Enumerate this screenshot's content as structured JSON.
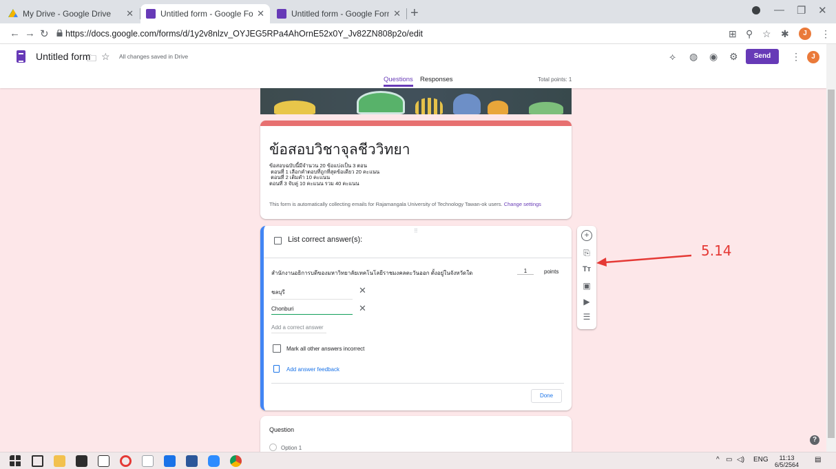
{
  "browser": {
    "tabs": [
      {
        "title": "My Drive - Google Drive",
        "favicon": "drive-icon"
      },
      {
        "title": "Untitled form - Google Forms",
        "favicon": "forms-icon"
      },
      {
        "title": "Untitled form - Google Forms",
        "favicon": "forms-icon"
      }
    ],
    "url": "https://docs.google.com/forms/d/1y2v8nlzv_OYJEG5RPa4AhOrnE52x0Y_Jv82ZN808p2o/edit",
    "profile_initial": "J"
  },
  "forms_header": {
    "title": "Untitled form",
    "saved_status": "All changes saved in Drive",
    "send_label": "Send",
    "tab_questions": "Questions",
    "tab_responses": "Responses",
    "total_points": "Total points: 1",
    "profile_initial": "J"
  },
  "title_card": {
    "title": "ข้อสอบวิชาจุลชีววิทยา",
    "description": "ข้อสอบฉบับนี้มีจำนวน 20 ข้อแบ่งเป็น 3 ตอน\n ตอนที่ 1 เลือกคำตอบที่ถูกที่สุดข้อเดียว 20 คะแนน\n ตอนที่ 2 เติมคำ 10 คะแนน\nตอนที่ 3 จับคู่ 10 คะแนน รวม 40 คะแนน",
    "notice": "This form is automatically collecting emails for Rajamangala University of Technology Tawan-ok users.",
    "notice_link": "Change settings"
  },
  "answer_card": {
    "header": "List correct answer(s):",
    "question": "สำนักงานอธิการบดีของมหาวิทยาลัยเทคโนโลยีราชมงคลตะวันออก ตั้งอยู่ในจังหวัดใด",
    "points_value": "1",
    "points_label": "points",
    "answers": [
      "ชลบุรี",
      "Chonburi"
    ],
    "add_answer_placeholder": "Add a correct answer",
    "mark_incorrect_label": "Mark all other answers incorrect",
    "feedback_label": "Add answer feedback",
    "done_label": "Done"
  },
  "question_card": {
    "label": "Question",
    "option1": "Option 1"
  },
  "annotation": {
    "label": "5.14",
    "color": "#e53935"
  },
  "taskbar": {
    "lang": "ENG",
    "time": "11:13",
    "date": "6/5/2564"
  },
  "colors": {
    "accent": "#673ab7",
    "background": "#fde7e9",
    "active_border": "#4285f4"
  }
}
